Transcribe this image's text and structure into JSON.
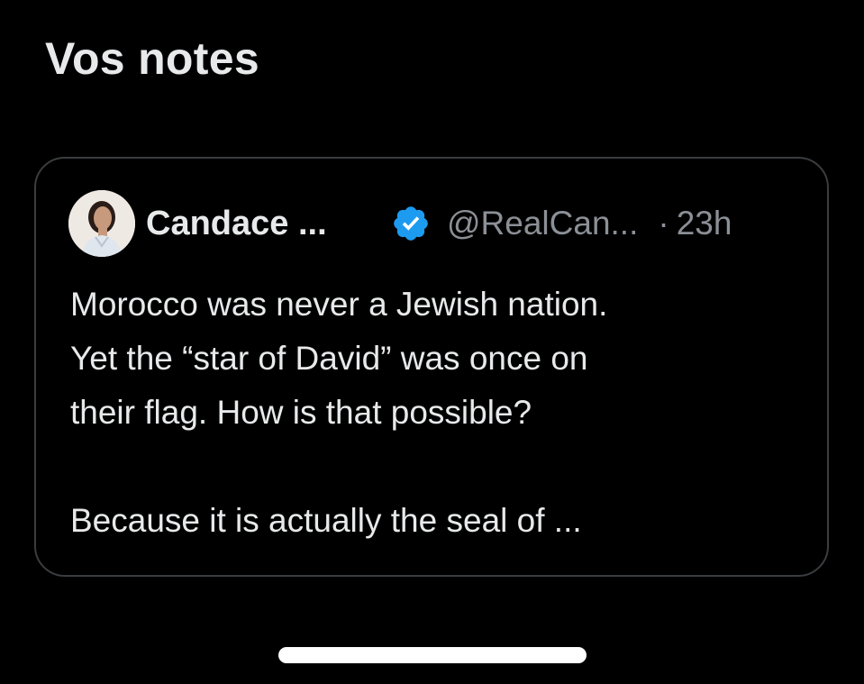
{
  "page": {
    "title": "Vos notes"
  },
  "note_card": {
    "author_name": "Candace ...",
    "handle": "@RealCan...",
    "separator": "·",
    "time": "23h",
    "lines": [
      "Morocco was never a Jewish nation.",
      "Yet the “star of David” was once on",
      "their flag. How is that possible?"
    ],
    "continuation": "Because it is actually the seal of ...",
    "verified_color": "#1d9bf0"
  }
}
